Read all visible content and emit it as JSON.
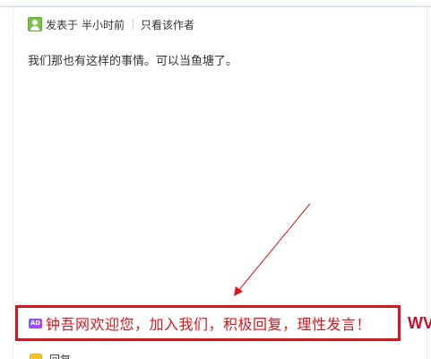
{
  "post": {
    "meta": {
      "posted_label": "发表于",
      "posted_time": "半小时前",
      "author_only_link": "只看该作者"
    },
    "content": "我们那也有这样的事情。可以当鱼塘了。"
  },
  "ad": {
    "badge": "AD",
    "message": "钟吾网欢迎您，加入我们，积极回复，理性发言！",
    "watermark_partial": "WV",
    "border_color": "#d9151b"
  },
  "reply": {
    "label": "回复"
  },
  "colors": {
    "accent_red": "#d9151b",
    "text": "#333333",
    "author_icon": "#7cc34a",
    "reply_icon": "#f4c430"
  }
}
